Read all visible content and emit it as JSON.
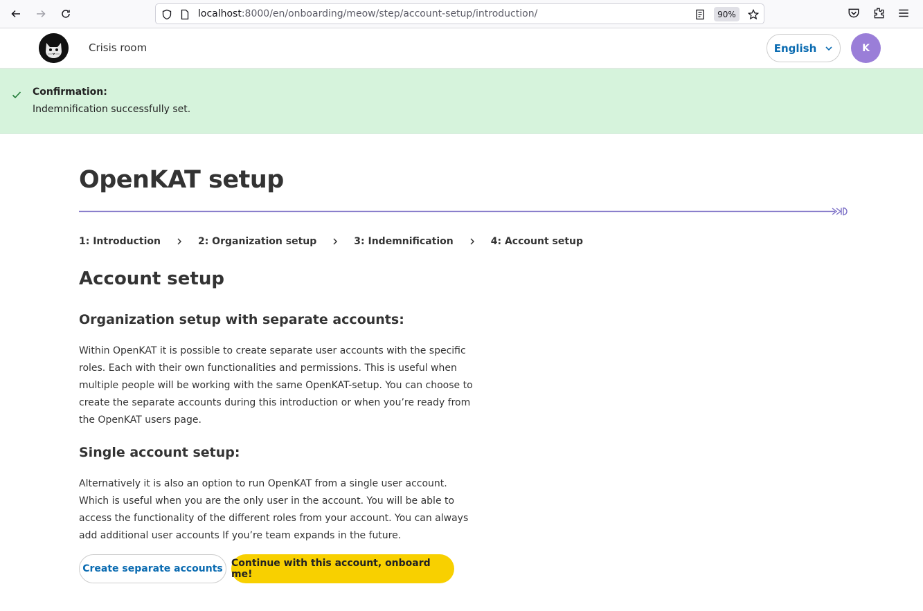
{
  "browser": {
    "url_host": "localhost",
    "url_path": ":8000/en/onboarding/meow/step/account-setup/introduction/",
    "zoom": "90%",
    "icons": [
      "back-arrow-icon",
      "forward-arrow-icon",
      "reload-icon",
      "shield-icon",
      "page-icon",
      "reader-mode-icon",
      "bookmark-star-icon",
      "pocket-icon",
      "extensions-icon",
      "menu-icon"
    ]
  },
  "header": {
    "crisis_room": "Crisis room",
    "language": "English",
    "avatar_initial": "K"
  },
  "confirmation": {
    "title": "Confirmation:",
    "message": "Indemnification successfully set."
  },
  "main": {
    "title": "OpenKAT setup",
    "steps": [
      "1: Introduction",
      "2: Organization setup",
      "3: Indemnification",
      "4: Account setup"
    ],
    "section_title": "Account setup",
    "separate_heading": "Organization setup with separate accounts:",
    "separate_text": "Within OpenKAT it is possible to create separate user accounts with the specific roles. Each with their own functionalities and permissions. This is useful when multiple people will be working with the same OpenKAT-setup. You can choose to create the separate accounts during this introduction or when you’re ready from the OpenKAT users page.",
    "single_heading": "Single account setup:",
    "single_text": "Alternatively it is also an option to run OpenKAT from a single user account. Which is useful when you are the only user in the account. You will be able to access the functionality of the different roles from your account. You can always add additional user accounts If you’re team expands in the future.",
    "btn_separate": "Create separate accounts",
    "btn_continue": "Continue with this account, onboard me!"
  },
  "colors": {
    "accent_blue": "#0a6bb1",
    "accent_yellow": "#f8d000",
    "confirm_bg": "#d6f3dc",
    "progress_purple": "#7b6fc6",
    "avatar_bg": "#9a7ed8"
  }
}
